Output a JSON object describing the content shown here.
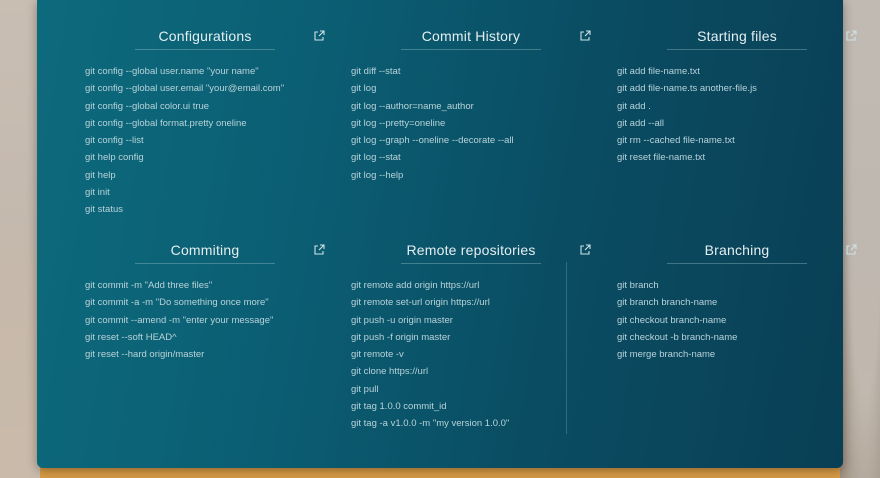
{
  "sections": [
    {
      "title": "Configurations",
      "commands": [
        "git config --global user.name \"your name\"",
        "git config --global user.email \"your@email.com\"",
        "git config --global color.ui true",
        "git config --global format.pretty oneline",
        "git config --list",
        "git help config",
        "git help",
        "git init",
        "git status"
      ]
    },
    {
      "title": "Commit History",
      "commands": [
        "git diff --stat",
        "git log",
        "git log --author=name_author",
        "git log --pretty=oneline",
        "git log --graph --oneline --decorate --all",
        "git log --stat",
        "git log --help"
      ]
    },
    {
      "title": "Starting files",
      "commands": [
        "git add file-name.txt",
        "git add file-name.ts another-file.js",
        "git add .",
        "git add --all",
        "git rm --cached file-name.txt",
        "git reset file-name.txt"
      ]
    },
    {
      "title": "Commiting",
      "commands": [
        "git commit -m \"Add three files\"",
        "git commit -a -m \"Do something once more\"",
        "git commit --amend -m \"enter your message\"",
        "git reset --soft HEAD^",
        "git reset --hard origin/master"
      ]
    },
    {
      "title": "Remote repositories",
      "commands": [
        "git remote add origin https://url",
        "git remote set-url origin https://url",
        "git push -u origin master",
        "git push -f origin master",
        "git remote -v",
        "git clone https://url",
        "git pull",
        "git tag 1.0.0 commit_id",
        "git tag -a v1.0.0 -m \"my version 1.0.0\""
      ]
    },
    {
      "title": "Branching",
      "commands": [
        "git branch",
        "git branch branch-name",
        "git checkout branch-name",
        "git checkout -b branch-name",
        "git merge branch-name"
      ]
    }
  ],
  "icons": {
    "external_link": "external-link-icon"
  },
  "colors": {
    "panel_start": "#0d6a7c",
    "panel_end": "#093f55",
    "title_text": "#e4eef1",
    "command_text": "#b8d3da"
  }
}
